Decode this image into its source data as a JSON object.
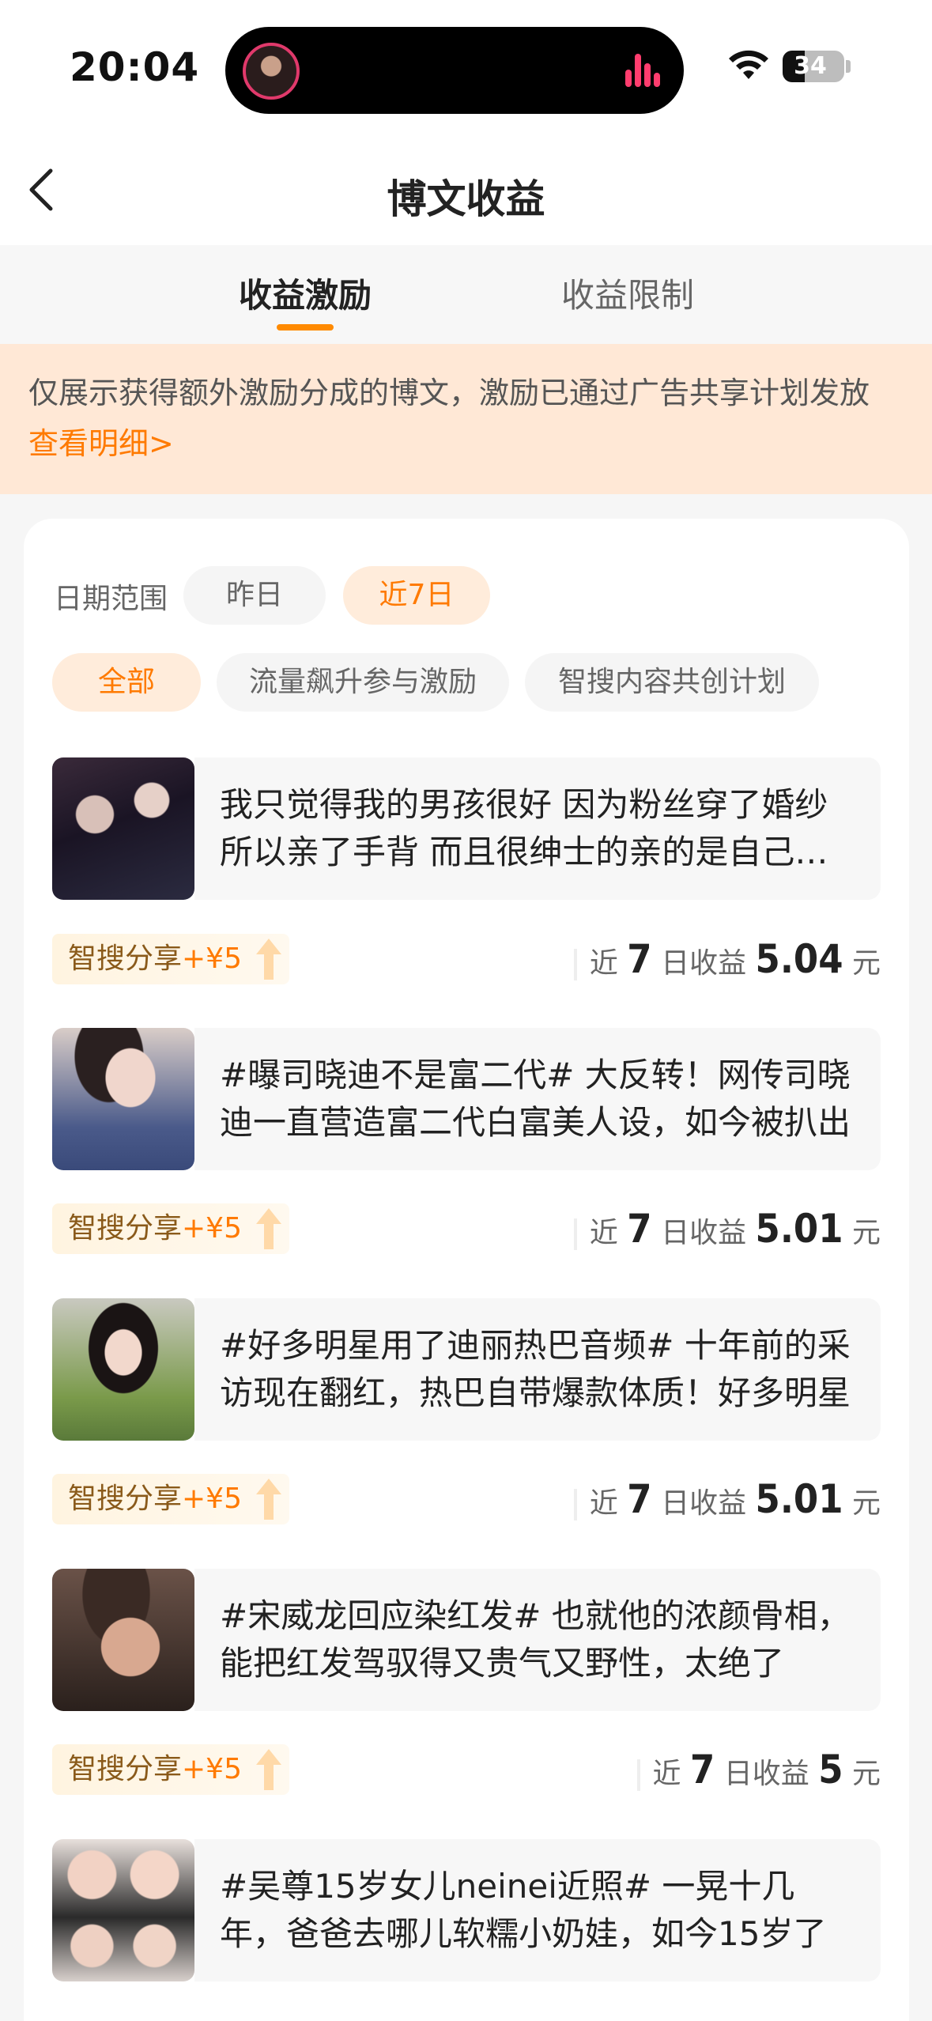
{
  "status_bar": {
    "time": "20:04",
    "battery": "34"
  },
  "nav": {
    "title": "博文收益"
  },
  "tabs": [
    {
      "label": "收益激励",
      "active": true
    },
    {
      "label": "收益限制",
      "active": false
    }
  ],
  "notice": {
    "text": "仅展示获得额外激励分成的博文，激励已通过广告共享计划发放",
    "link": "查看明细>"
  },
  "filters": {
    "date_label": "日期范围",
    "date_options": [
      "昨日",
      "近7日"
    ],
    "date_selected": "近7日",
    "category_options": [
      "全部",
      "流量飙升参与激励",
      "智搜内容共创计划"
    ],
    "category_selected": "全部"
  },
  "earnings_labels": {
    "prefix": "近",
    "days": "7",
    "suffix": "日收益",
    "unit": "元"
  },
  "posts": [
    {
      "text": "我只觉得我的男孩很好 因为粉丝穿了婚纱所以亲了手背 而且很绅士的亲的是自己的手",
      "badge_prefix": "智搜分享",
      "badge_amount": "+¥5",
      "earnings": "5.04"
    },
    {
      "text": "#曝司晓迪不是富二代# 大反转！网传司晓迪一直营造富二代白富美人设，如今被扒出",
      "badge_prefix": "智搜分享",
      "badge_amount": "+¥5",
      "earnings": "5.01"
    },
    {
      "text": "#好多明星用了迪丽热巴音频# 十年前的采访现在翻红，热巴自带爆款体质！好多明星",
      "badge_prefix": "智搜分享",
      "badge_amount": "+¥5",
      "earnings": "5.01"
    },
    {
      "text": "#宋威龙回应染红发# 也就他的浓颜骨相，能把红发驾驭得又贵气又野性，太绝了",
      "badge_prefix": "智搜分享",
      "badge_amount": "+¥5",
      "earnings": "5"
    },
    {
      "text": "#吴尊15岁女儿neinei近照# 一晃十几年，爸爸去哪儿软糯小奶娃，如今15岁了",
      "badge_prefix": "智搜分享",
      "badge_amount": "+¥5",
      "earnings": ""
    }
  ],
  "colors": {
    "accent": "#ff7a00",
    "notice_bg": "#ffe8d6",
    "chip_active_bg": "#ffecdb"
  }
}
